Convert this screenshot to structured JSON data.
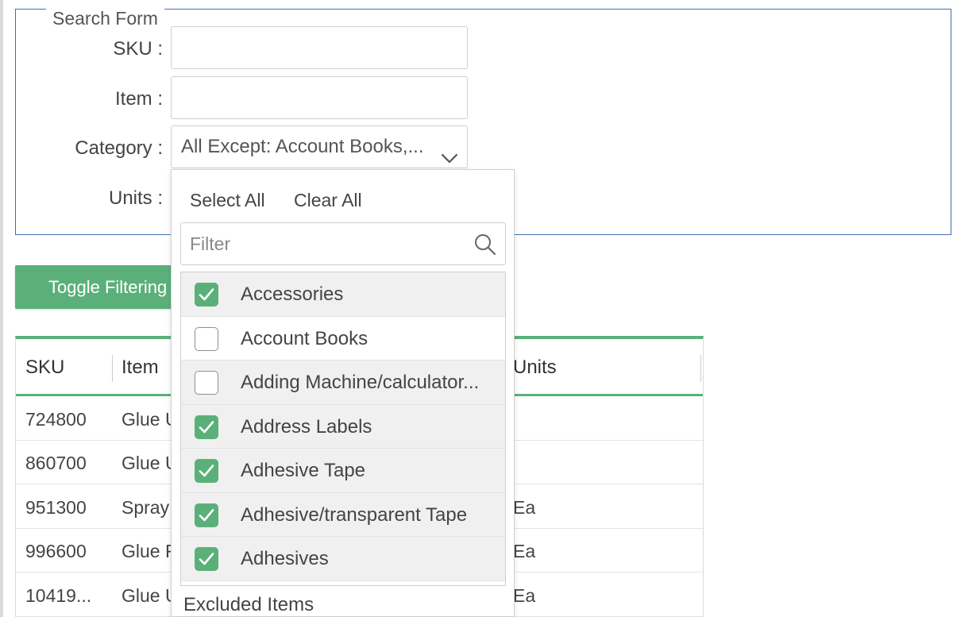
{
  "search_form": {
    "legend": "Search Form",
    "sku_label": "SKU :",
    "sku_value": "",
    "item_label": "Item :",
    "item_value": "",
    "category_label": "Category :",
    "category_value": "All Except: Account Books,...",
    "units_label": "Units :"
  },
  "toggle_button": {
    "label": "Toggle Filtering"
  },
  "grid": {
    "columns": {
      "sku": "SKU",
      "item": "Item",
      "units": "Units"
    },
    "rows": [
      {
        "sku": "724800",
        "item": "Glue U",
        "units": ""
      },
      {
        "sku": "860700",
        "item": "Glue U",
        "units": ""
      },
      {
        "sku": "951300",
        "item": "Spray",
        "units": "Ea"
      },
      {
        "sku": "996600",
        "item": "Glue F",
        "units": "Ea"
      },
      {
        "sku": "10419...",
        "item": "Glue U",
        "units": "Ea"
      }
    ]
  },
  "dropdown": {
    "select_all": "Select All",
    "clear_all": "Clear All",
    "filter_placeholder": "Filter",
    "filter_icon": "search-icon",
    "options": [
      {
        "label": "Accessories",
        "checked": true
      },
      {
        "label": "Account Books",
        "checked": false
      },
      {
        "label": "Adding Machine/calculator...",
        "checked": false
      },
      {
        "label": "Address Labels",
        "checked": true
      },
      {
        "label": "Adhesive Tape",
        "checked": true
      },
      {
        "label": "Adhesive/transparent Tape",
        "checked": true
      },
      {
        "label": "Adhesives",
        "checked": true
      }
    ],
    "footer": "Excluded Items"
  },
  "colors": {
    "accent_green": "#5bb07a",
    "fieldset_border": "#3f6fb0"
  }
}
